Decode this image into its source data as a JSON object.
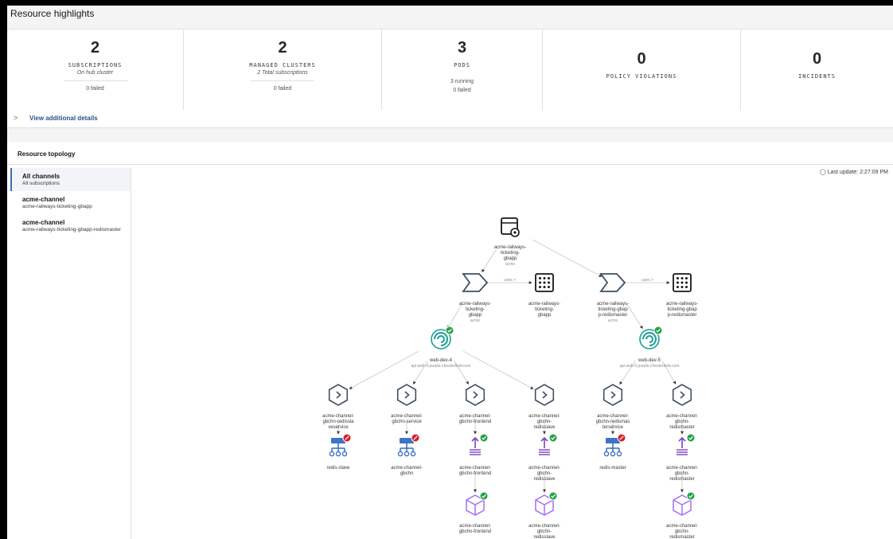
{
  "header": {
    "title": "Resource highlights"
  },
  "highlights": [
    {
      "value": "2",
      "label": "SUBSCRIPTIONS",
      "sub": "On hub cluster",
      "foot": [
        "0 failed"
      ]
    },
    {
      "value": "2",
      "label": "MANAGED CLUSTERS",
      "sub": "2 Total subscriptions",
      "foot": [
        "0 failed"
      ]
    },
    {
      "value": "3",
      "label": "PODS",
      "sub": "",
      "foot": [
        "3 running",
        "0 failed"
      ]
    },
    {
      "value": "0",
      "label": "POLICY VIOLATIONS",
      "sub": "",
      "foot": []
    },
    {
      "value": "0",
      "label": "INCIDENTS",
      "sub": "",
      "foot": []
    }
  ],
  "details": {
    "chevron": ">",
    "label": "View additional details"
  },
  "topology": {
    "title": "Resource topology",
    "last_update": "Last update: 2:27:09 PM",
    "channels": [
      {
        "name": "All channels",
        "sub": "All subscriptions",
        "active": true
      },
      {
        "name": "acme-channel",
        "sub": "acme-railways-ticketing-gbapp",
        "active": false
      },
      {
        "name": "acme-channel",
        "sub": "acme-railways-ticketing-gbapp-redismaster",
        "active": false
      }
    ],
    "edge_label": "uses >",
    "nodes": [
      {
        "id": "app",
        "kind": "application",
        "label": [
          "acme-railways-",
          "ticketing-",
          "gbapp"
        ],
        "sub": "acme",
        "status": ""
      },
      {
        "id": "sub1",
        "kind": "subscription",
        "label": [
          "acme-railways-",
          "ticketing-",
          "gbapp"
        ],
        "sub": "acme",
        "status": ""
      },
      {
        "id": "rule1",
        "kind": "placement",
        "label": [
          "acme-railways-",
          "ticketing-",
          "gbapp"
        ],
        "sub": "",
        "status": ""
      },
      {
        "id": "sub2",
        "kind": "subscription",
        "label": [
          "acme-railways-",
          "ticketing-gbap",
          "p-redismaster"
        ],
        "sub": "acme",
        "status": ""
      },
      {
        "id": "rule2",
        "kind": "placement",
        "label": [
          "acme-railways-",
          "ticketing-gbap",
          "p-redismaster"
        ],
        "sub": "",
        "status": ""
      },
      {
        "id": "cl1",
        "kind": "cluster",
        "label": [
          "web-dev-4"
        ],
        "sub": "api.web-4.purple-chesterfield.com",
        "status": "ok"
      },
      {
        "id": "cl2",
        "kind": "cluster",
        "label": [
          "web-dev-5"
        ],
        "sub": "api.web-5.purple-chesterfield.com",
        "status": "ok"
      },
      {
        "id": "s1",
        "kind": "service",
        "label": [
          "acme-channel-",
          "gbchn-redissla",
          "veservice"
        ],
        "sub": "",
        "status": ""
      },
      {
        "id": "s2",
        "kind": "service",
        "label": [
          "acme-channel-",
          "gbchn-service"
        ],
        "sub": "",
        "status": ""
      },
      {
        "id": "s3",
        "kind": "service",
        "label": [
          "acme-channel-",
          "gbchn-frontend"
        ],
        "sub": "",
        "status": ""
      },
      {
        "id": "s4",
        "kind": "service",
        "label": [
          "acme-channel-",
          "gbchn-",
          "redisslave"
        ],
        "sub": "",
        "status": ""
      },
      {
        "id": "s5",
        "kind": "service",
        "label": [
          "acme-channel-",
          "gbchn-redismas",
          "terservice"
        ],
        "sub": "",
        "status": ""
      },
      {
        "id": "s6",
        "kind": "service",
        "label": [
          "acme-channel-",
          "gbchn-",
          "redismaster"
        ],
        "sub": "",
        "status": ""
      },
      {
        "id": "d1",
        "kind": "deployable",
        "label": [
          "redis-slave"
        ],
        "sub": "",
        "status": "error"
      },
      {
        "id": "d2",
        "kind": "deployable",
        "label": [
          "acme-channel-",
          "gbchn"
        ],
        "sub": "",
        "status": "error"
      },
      {
        "id": "d3",
        "kind": "deployment",
        "label": [
          "acme-channel-",
          "gbchn-frontend"
        ],
        "sub": "",
        "status": "ok"
      },
      {
        "id": "d4",
        "kind": "deployment",
        "label": [
          "acme-channel-",
          "gbchn-",
          "redisslave"
        ],
        "sub": "",
        "status": "ok"
      },
      {
        "id": "d5",
        "kind": "deployable",
        "label": [
          "redis-master"
        ],
        "sub": "",
        "status": "error"
      },
      {
        "id": "d6",
        "kind": "deployment",
        "label": [
          "acme-channel-",
          "gbchn-",
          "redismaster"
        ],
        "sub": "",
        "status": "ok"
      },
      {
        "id": "p3",
        "kind": "pod",
        "label": [
          "acme-channel-",
          "gbchn-frontend"
        ],
        "sub": "",
        "status": "ok"
      },
      {
        "id": "p4",
        "kind": "pod",
        "label": [
          "acme-channel-",
          "gbchn-",
          "redisslave"
        ],
        "sub": "",
        "status": "ok"
      },
      {
        "id": "p6",
        "kind": "pod",
        "label": [
          "acme-channel-",
          "gbchn-",
          "redismaster"
        ],
        "sub": "",
        "status": "ok"
      }
    ],
    "edges": [
      [
        "app",
        "sub1",
        ""
      ],
      [
        "app",
        "sub2",
        ""
      ],
      [
        "sub1",
        "rule1",
        "uses"
      ],
      [
        "sub2",
        "rule2",
        "uses"
      ],
      [
        "sub1",
        "cl1",
        ""
      ],
      [
        "sub2",
        "cl2",
        ""
      ],
      [
        "cl1",
        "s1",
        ""
      ],
      [
        "cl1",
        "s2",
        ""
      ],
      [
        "cl1",
        "s3",
        ""
      ],
      [
        "cl1",
        "s4",
        ""
      ],
      [
        "cl2",
        "s5",
        ""
      ],
      [
        "cl2",
        "s6",
        ""
      ],
      [
        "s1",
        "d1",
        ""
      ],
      [
        "s2",
        "d2",
        ""
      ],
      [
        "s3",
        "d3",
        ""
      ],
      [
        "s4",
        "d4",
        ""
      ],
      [
        "s5",
        "d5",
        ""
      ],
      [
        "s6",
        "d6",
        ""
      ],
      [
        "d3",
        "p3",
        ""
      ],
      [
        "d4",
        "p4",
        ""
      ],
      [
        "d6",
        "p6",
        ""
      ]
    ],
    "colors": {
      "subscription": "#3d4f63",
      "cluster": "#1a9e9a",
      "service": "#3d4f63",
      "deployable": "#3e73c7",
      "deployment": "#7b3fc0",
      "pod": "#a66efa",
      "ok": "#24a148",
      "error": "#da1e28",
      "edge": "#c6c6c6"
    }
  }
}
